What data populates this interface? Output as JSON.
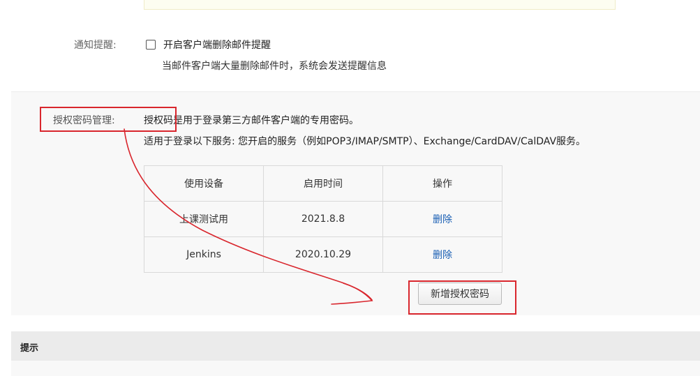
{
  "notify": {
    "label": "通知提醒:",
    "checkbox_label": "开启客户端删除邮件提醒",
    "description": "当邮件客户端大量删除邮件时，系统会发送提醒信息"
  },
  "auth": {
    "label": "授权密码管理:",
    "desc_line1": "授权码是用于登录第三方邮件客户端的专用密码。",
    "desc_line2": "适用于登录以下服务: 您开启的服务（例如POP3/IMAP/SMTP）、Exchange/CardDAV/CalDAV服务。",
    "table": {
      "headers": [
        "使用设备",
        "启用时间",
        "操作"
      ],
      "rows": [
        {
          "device": "上课测试用",
          "date": "2021.8.8",
          "action": "删除"
        },
        {
          "device": "Jenkins",
          "date": "2020.10.29",
          "action": "删除"
        }
      ]
    },
    "add_button": "新增授权密码"
  },
  "tips": {
    "title": "提示"
  },
  "colors": {
    "link": "#1a5fb4",
    "annotation": "#d9262d",
    "panel_bg": "#f8f8f8"
  }
}
